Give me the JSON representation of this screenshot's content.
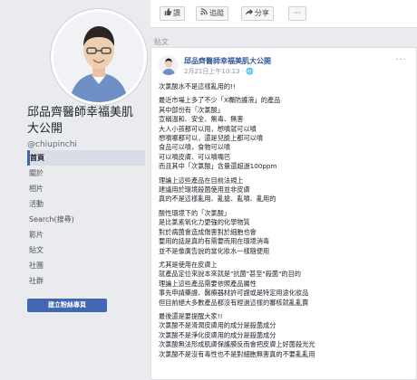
{
  "toolbar": {
    "like_label": "讚",
    "follow_label": "追蹤",
    "share_label": "分享",
    "more_label": "···"
  },
  "sidebar": {
    "page_name": "邱品齊醫師幸福美肌大公開",
    "handle": "@chiupinchi",
    "nav": [
      {
        "label": "首頁",
        "active": true
      },
      {
        "label": "關於",
        "active": false
      },
      {
        "label": "相片",
        "active": false
      },
      {
        "label": "活動",
        "active": false
      },
      {
        "label": "Search(搜尋)",
        "active": false
      },
      {
        "label": "影片",
        "active": false
      },
      {
        "label": "貼文",
        "active": false
      },
      {
        "label": "社團",
        "active": false
      },
      {
        "label": "社群",
        "active": false
      }
    ],
    "cta_label": "建立粉絲專頁"
  },
  "posts_label": "貼文",
  "post": {
    "author": "邱品齊醫師幸福美肌大公開",
    "timestamp": "2月21日上午10:13 · 🌐",
    "more": "···",
    "paragraphs": [
      [
        "次氯酸水不是這樣亂用的!!"
      ],
      [
        "最近市場上多了不少「X欄防護液」的產品",
        "其中部份有「次氯酸」",
        "宣稱溫和、安全、無毒、無害",
        "大人小孩都可以用，想噴就可以噴",
        "想噴哪都可以，還是兒臉上都可以噴",
        "食品可以噴，食物可以噴",
        "可以噴皮膚、可以噴嘴巴",
        "而且其中「次氯酸」含量還超過100ppm"
      ],
      [
        "理論上這些產品在目前法規上",
        "建議用於環境殺菌使用並非皮膚",
        "真的不是這樣亂用、亂搶、亂噴、亂用的"
      ],
      [
        "酸性環境下的「次氯酸」",
        "是比氯素氧化力更強的化學物質",
        "對於病菌會造成傷害對於細胞也會",
        "要用的話是真的有需要而用在環境消毒",
        "並不是像廣告說的當化妝水一樣隨便用"
      ],
      [
        "尤其是使用在皮膚上",
        "就產品定位來說本來就是\"抗菌\"甚至\"殺菌\"的目的",
        "理論上這些產品需要依照產品屬性",
        "事先申請藥證、醫療器材許可證或是特定用途化妝品",
        "但目前絕大多數產品都沒有經過這樣的審核就亂亂賣"
      ],
      [
        "最後還是要提醒大家!!",
        "次氯酸不是滑潤皮膚用的成分是殺菌成分",
        "次氯酸不是淨化皮膚用的成分是殺菌成分",
        "次氯酸無法形成肌膚保護膜反而會把皮膚上好菌殺光光",
        "次氯酸不是沒有毒性也不是對細胞無害真的不要亂亂用"
      ]
    ]
  }
}
